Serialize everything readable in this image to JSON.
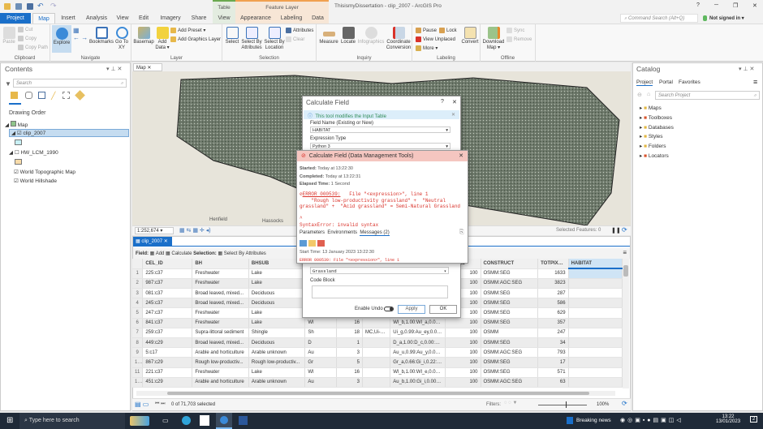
{
  "window": {
    "title": "ThisismyDissertation - clip_2007 - ArcGIS Pro",
    "help": "?",
    "minimize": "─",
    "restore": "❐",
    "close": "✕"
  },
  "context_tabs": {
    "table": "Table",
    "feature_layer": "Feature Layer"
  },
  "tabs": [
    "Project",
    "Map",
    "Insert",
    "Analysis",
    "View",
    "Edit",
    "Imagery",
    "Share",
    "View",
    "Appearance",
    "Labeling",
    "Data"
  ],
  "command_search": {
    "placeholder": "Command Search (Alt+Q)"
  },
  "account": {
    "label": "Not signed in ▾"
  },
  "ribbon": {
    "clipboard": {
      "label": "Clipboard",
      "paste": "Paste",
      "cut": "Cut",
      "copy": "Copy",
      "copy_path": "Copy Path"
    },
    "navigate": {
      "label": "Navigate",
      "explore": "Explore",
      "bookmarks": "Bookmarks",
      "go_to_xy": "Go To XY"
    },
    "layer": {
      "label": "Layer",
      "basemap": "Basemap",
      "add_data": "Add Data ▾",
      "add_preset": "Add Preset ▾",
      "add_graphics_layer": "Add Graphics Layer"
    },
    "selection": {
      "label": "Selection",
      "select": "Select",
      "select_by_attributes": "Select By Attributes",
      "select_by_location": "Select By Location",
      "attributes": "Attributes",
      "clear": "Clear"
    },
    "inquiry": {
      "label": "Inquiry",
      "measure": "Measure",
      "locate": "Locate",
      "infographics": "Infographics",
      "coordinate_conversion": "Coordinate Conversion"
    },
    "labeling": {
      "label": "Labeling",
      "pause": "Pause",
      "lock": "Lock",
      "view_unplaced": "View Unplaced",
      "more": "More ▾",
      "convert": "Convert"
    },
    "offline": {
      "label": "Offline",
      "download_map": "Download Map ▾",
      "sync": "Sync",
      "remove": "Remove"
    }
  },
  "contents": {
    "title": "Contents",
    "search_placeholder": "Search",
    "drawing_order": "Drawing Order",
    "layers": [
      {
        "name": "Map",
        "checked": true
      },
      {
        "name": "clip_2007",
        "checked": true,
        "color": "#c8f0f5"
      },
      {
        "name": "HW_LCM_1990",
        "checked": false,
        "color": "#f8dcaa"
      },
      {
        "name": "World Topographic Map",
        "checked": true
      },
      {
        "name": "World Hillshade",
        "checked": true
      }
    ]
  },
  "map_view": {
    "tab": "Map",
    "scale": "1:252,674",
    "selected_features": "Selected Features: 0",
    "place_labels": [
      "Henfield",
      "Hassocks"
    ]
  },
  "catalog": {
    "title": "Catalog",
    "tabs": [
      "Project",
      "Portal",
      "Favorites"
    ],
    "search_placeholder": "Search Project",
    "items": [
      "Maps",
      "Toolboxes",
      "Databases",
      "Styles",
      "Folders",
      "Locators"
    ]
  },
  "calc_field": {
    "title": "Calculate Field",
    "info": "This tool modifies the Input Table",
    "field_name_label": "Field Name (Existing or New)",
    "field_name": "HABITAT",
    "expr_type_label": "Expression Type",
    "expr_type": "Python 3",
    "expression": "Grassland",
    "code_block_label": "Code Block",
    "enable_undo": "Enable Undo",
    "apply": "Apply",
    "ok": "OK"
  },
  "error_popup": {
    "title": "Calculate Field (Data Management Tools)",
    "started_label": "Started:",
    "started": "Today at 13:22:30",
    "completed_label": "Completed:",
    "completed": "Today at 13:22:31",
    "elapsed_label": "Elapsed Time:",
    "elapsed": "1 Second",
    "error_code": "ERROR 000539:",
    "error_line1": "File \"<expression>\", line 1",
    "error_line2": "\"Rough low-productivity grassland\" +  \"Neutral",
    "error_line3": "grassland\" +  \"Acid grassland\" = Semi-Natural Grassland",
    "error_caret": "^",
    "error_syntax": "SyntaxError: invalid syntax",
    "tabs": [
      "Parameters",
      "Environments",
      "Messages (2)"
    ],
    "start_time": "Start Time: 13 January 2023 13:22:30",
    "msg_preview": "ERROR 000539:   File \"<expression>\", line 1"
  },
  "table_view": {
    "tab": "clip_2007",
    "field_label": "Field:",
    "add": "Add",
    "calculate": "Calculate",
    "selection_label": "Selection:",
    "select_by_attributes": "Select By Attributes",
    "columns": [
      "CEL_ID",
      "BH",
      "BHSUB",
      "",
      "",
      "",
      "",
      "PIXELS",
      "CONSTRUCT",
      "TOTPIXELS",
      "HABITAT"
    ],
    "rows": [
      [
        "1",
        "225:c37",
        "Freshwater",
        "Lake",
        "Wl",
        "",
        "",
        "",
        "100",
        "OSMM:SEG",
        "1633",
        ""
      ],
      [
        "2",
        "987:c37",
        "Freshwater",
        "Lake",
        "Wl",
        "",
        "",
        "",
        "100",
        "OSMM:AGC:SEG",
        "3823",
        ""
      ],
      [
        "3",
        "081:c37",
        "Broad leaved, mixed...",
        "Deciduous",
        "D",
        "",
        "",
        "",
        "100",
        "OSMM:SEG",
        "287",
        ""
      ],
      [
        "4",
        "245:c37",
        "Broad leaved, mixed...",
        "Deciduous",
        "D",
        "",
        "",
        "",
        "100",
        "OSMM:SEG",
        "586",
        ""
      ],
      [
        "5",
        "247:c37",
        "Freshwater",
        "Lake",
        "Wl",
        "",
        "",
        "",
        "100",
        "OSMM:SEG",
        "629",
        ""
      ],
      [
        "6",
        "841:c37",
        "Freshwater",
        "Lake",
        "Wl",
        "16",
        "",
        "Wl_b,1.00:Wl_a,0.00:U...",
        "100",
        "OSMM:SEG",
        "357",
        ""
      ],
      [
        "7",
        "259:c37",
        "Supra-littoral sediment",
        "Shingle",
        "Sh",
        "18",
        "MC,Ui->Sh",
        "Ui_g,0.99:Au_ey,0.01:...",
        "100",
        "OSMM",
        "247",
        ""
      ],
      [
        "8",
        "449:c29",
        "Broad leaved, mixed...",
        "Deciduous",
        "D",
        "1",
        "",
        "D_a,1.00:D_c,0.00:Gr_...",
        "100",
        "OSMM:SEG",
        "34",
        ""
      ],
      [
        "9",
        "5:c17",
        "Arable and horticulture",
        "Arable unknown",
        "Au",
        "3",
        "",
        "Au_u,0.99:Au_y,0.01:...",
        "100",
        "OSMM:AGC:SEG",
        "793",
        ""
      ],
      [
        "10",
        "867:c29",
        "Rough low-productiv...",
        "Rough low-productiv...",
        "Gr",
        "5",
        "",
        "Gr_a,0.66:Gi_i,0.22:D_...",
        "100",
        "OSMM:SEG",
        "17",
        ""
      ],
      [
        "11",
        "221:c37",
        "Freshwater",
        "Lake",
        "Wl",
        "16",
        "",
        "Wl_b,1.00:Wl_e,0.00:...",
        "100",
        "OSMM:SEG",
        "571",
        ""
      ],
      [
        "12",
        "451:c29",
        "Arable and horticulture",
        "Arable unknown",
        "Au",
        "3",
        "",
        "Au_b,1.00:Gi_i,0.00:A...",
        "100",
        "OSMM:AGC:SEG",
        "63",
        ""
      ]
    ],
    "status": "0 of 71,703 selected",
    "filters": "Filters:",
    "zoom": "100%"
  },
  "taskbar": {
    "search_placeholder": "Type here to search",
    "news": "Breaking news",
    "time": "13:22",
    "date": "13/01/2023",
    "notifications": "2"
  }
}
